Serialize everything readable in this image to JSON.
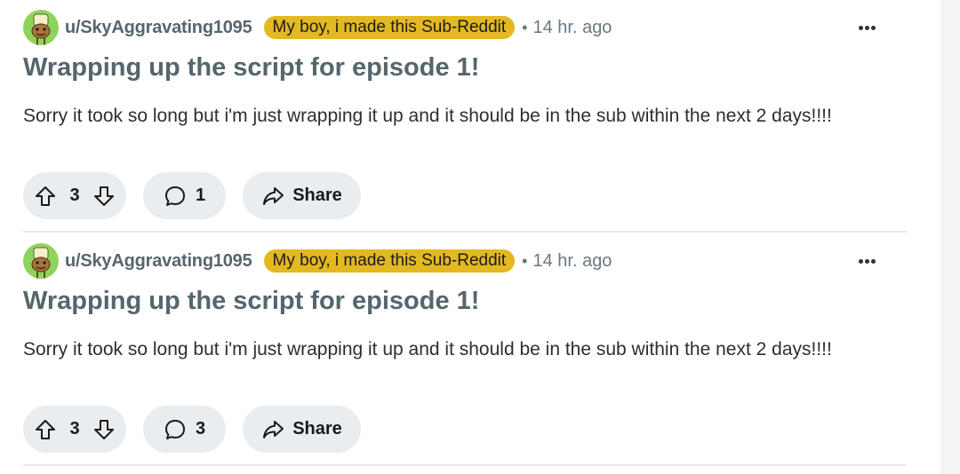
{
  "posts": [
    {
      "username": "u/SkyAggravating1095",
      "flair": "My boy, i made this Sub-Reddit",
      "separator": "•",
      "time": "14 hr. ago",
      "title": "Wrapping up the script for episode 1!",
      "body": "Sorry it took so long but i'm just wrapping it up and it should be in the sub within the next 2 days!!!!",
      "votes": "3",
      "comments": "1",
      "share_label": "Share"
    },
    {
      "username": "u/SkyAggravating1095",
      "flair": "My boy, i made this Sub-Reddit",
      "separator": "•",
      "time": "14 hr. ago",
      "title": "Wrapping up the script for episode 1!",
      "body": "Sorry it took so long but i'm just wrapping it up and it should be in the sub within the next 2 days!!!!",
      "votes": "3",
      "comments": "3",
      "share_label": "Share"
    }
  ],
  "colors": {
    "flair_bg": "#e3b820",
    "avatar_bg": "#8fd45a",
    "pill_bg": "#eaedef",
    "title": "#55666c"
  },
  "icons": [
    "avatar-icon",
    "more-options-icon",
    "upvote-icon",
    "downvote-icon",
    "comment-icon",
    "share-icon"
  ]
}
